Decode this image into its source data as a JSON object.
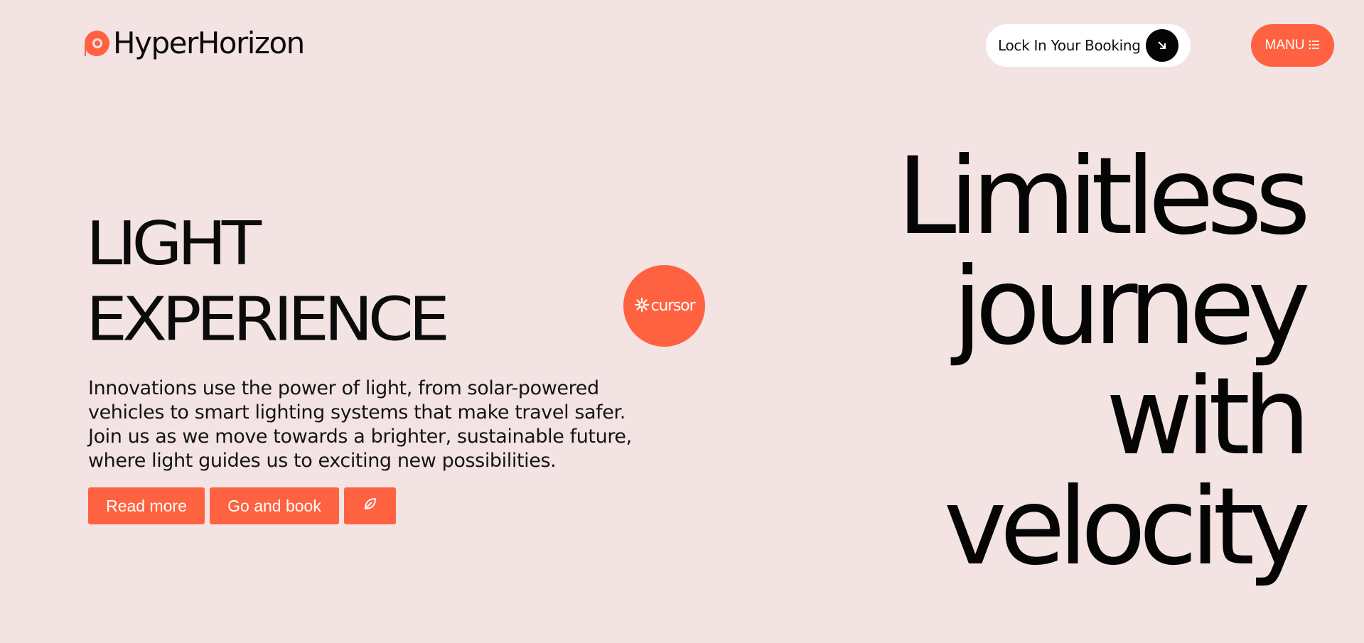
{
  "header": {
    "logo_text": "HyperHorizon",
    "booking_label": "Lock In Your Booking",
    "menu_label": "MANU"
  },
  "hero": {
    "title_line1": "LIGHT",
    "title_line2": "EXPERIENCE",
    "description": "Innovations use the power of light, from solar-powered vehicles to smart lighting systems that make travel safer. Join us as we move towards a brighter, sustainable future, where light guides us to exciting new possibilities.",
    "buttons": {
      "read_more": "Read more",
      "go_and_book": "Go and book"
    },
    "tagline": [
      "Limitless",
      "journey",
      "with",
      "velocity"
    ]
  },
  "badge": {
    "label": "cursor"
  },
  "icons": {
    "logo": "logo-mark-icon",
    "booking": "arrow-down-right-icon",
    "menu": "list-icon",
    "action": "leaf-icon",
    "badge": "snowflake-icon"
  },
  "colors": {
    "background": "#f3e3e3",
    "accent": "#ff6240",
    "text": "#0b0b0b",
    "pill": "#ffffff"
  }
}
